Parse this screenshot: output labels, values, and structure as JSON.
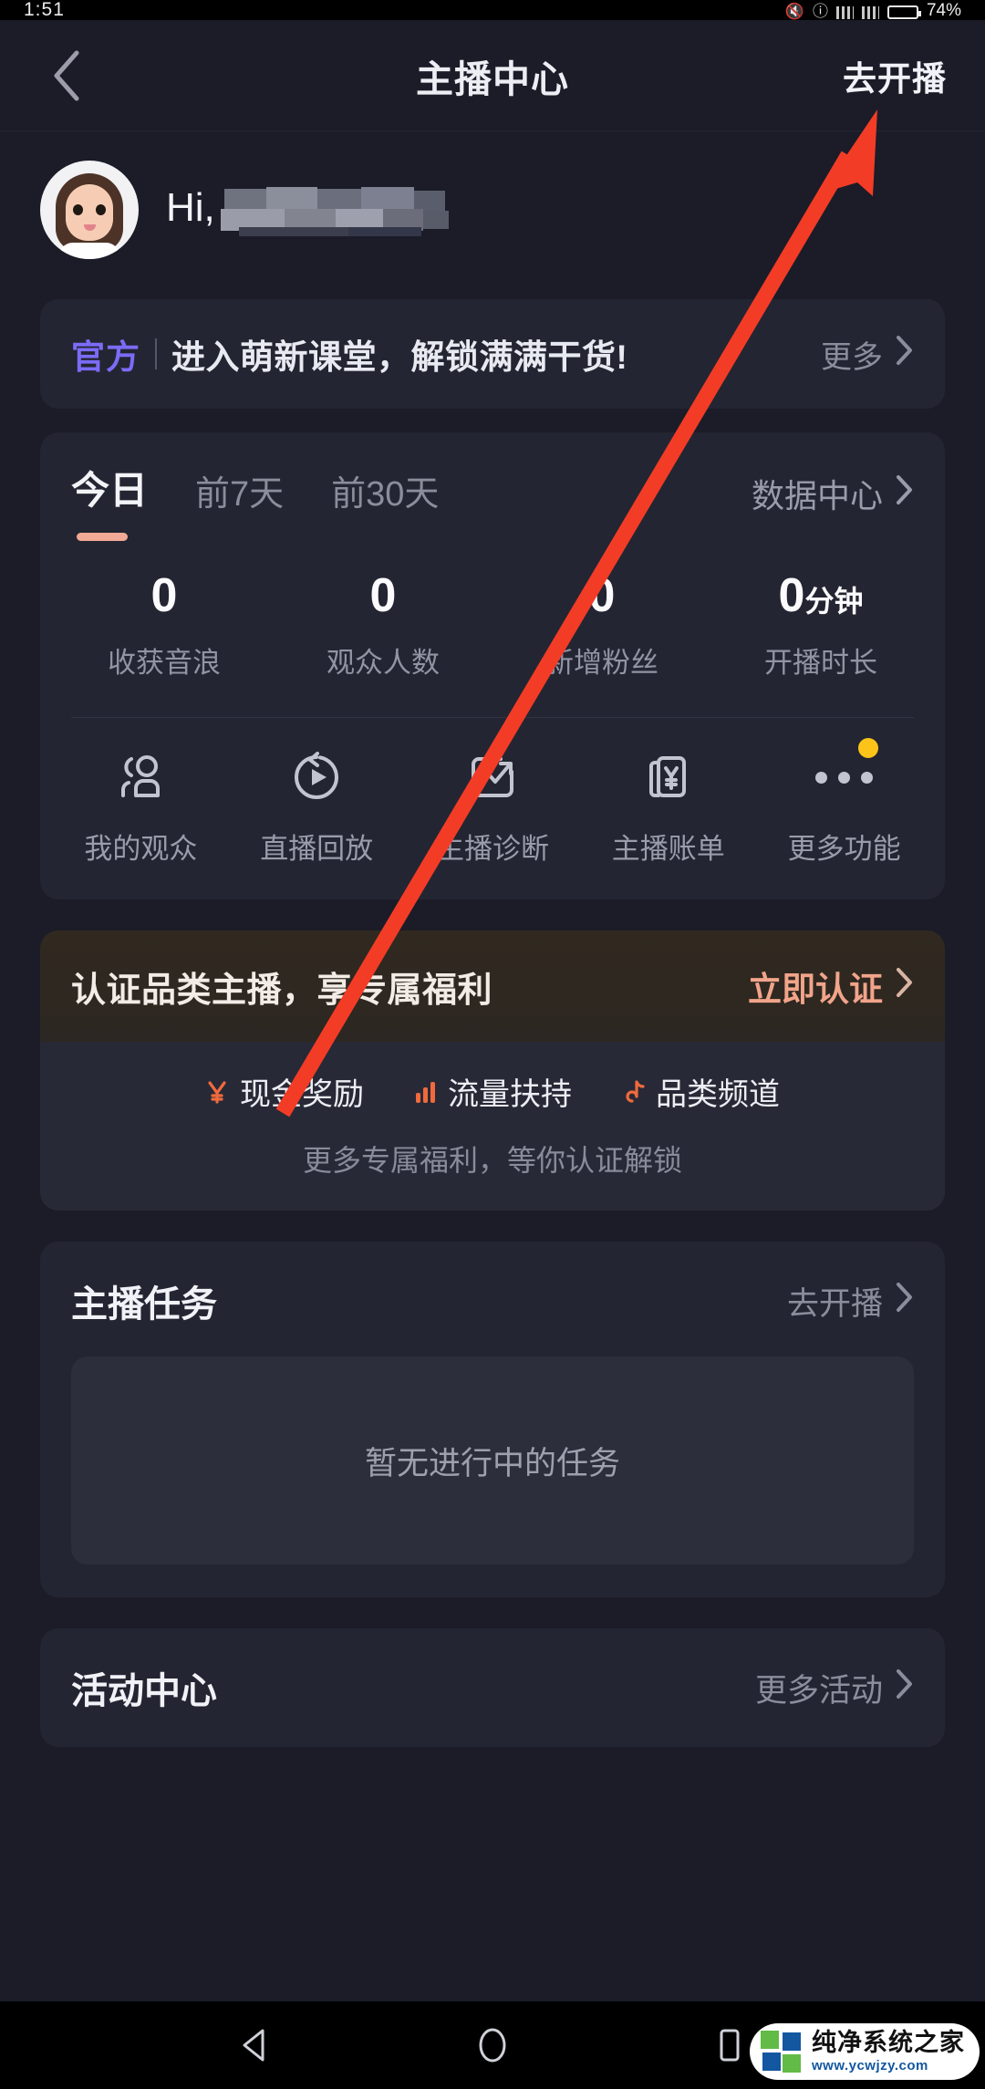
{
  "status_bar": {
    "time": "1:51",
    "battery_percent": "74%",
    "icons": [
      "mute-icon",
      "vpn-icon",
      "signal-icon",
      "signal-icon",
      "battery-icon"
    ]
  },
  "navbar": {
    "back_icon": "chevron-left-icon",
    "title": "主播中心",
    "action_label": "去开播"
  },
  "greeting": {
    "avatar": "avatar-image",
    "hi_text": "Hi,",
    "username_redacted": true
  },
  "banner": {
    "badge": "官方",
    "text": "进入萌新课堂，解锁满满干货!",
    "more_label": "更多",
    "chevron": "chevron-right-icon",
    "badge_color": "#7b6cf6"
  },
  "data_card": {
    "tabs": [
      {
        "label": "今日",
        "active": true
      },
      {
        "label": "前7天",
        "active": false
      },
      {
        "label": "前30天",
        "active": false
      }
    ],
    "data_center_label": "数据中心",
    "active_indicator_color": "#f2a995",
    "stats": [
      {
        "value": "0",
        "unit": "",
        "label": "收获音浪"
      },
      {
        "value": "0",
        "unit": "",
        "label": "观众人数"
      },
      {
        "value": "0",
        "unit": "",
        "label": "新增粉丝"
      },
      {
        "value": "0",
        "unit": "分钟",
        "label": "开播时长"
      }
    ],
    "quick_actions": [
      {
        "label": "我的观众",
        "icon": "people-icon",
        "badge": false
      },
      {
        "label": "直播回放",
        "icon": "replay-icon",
        "badge": false
      },
      {
        "label": "主播诊断",
        "icon": "chart-trend-icon",
        "badge": false
      },
      {
        "label": "主播账单",
        "icon": "bill-yen-icon",
        "badge": false
      },
      {
        "label": "更多功能",
        "icon": "more-dots-icon",
        "badge": true
      }
    ]
  },
  "certification": {
    "title": "认证品类主播，享专属福利",
    "cta_label": "立即认证",
    "cta_color": "#f2a48a",
    "perks": [
      {
        "label": "现金奖励",
        "icon": "yen-icon"
      },
      {
        "label": "流量扶持",
        "icon": "bar-chart-icon"
      },
      {
        "label": "品类频道",
        "icon": "music-note-icon"
      }
    ],
    "subtext": "更多专属福利，等你认证解锁"
  },
  "tasks": {
    "title": "主播任务",
    "link_label": "去开播",
    "empty_text": "暂无进行中的任务"
  },
  "activity": {
    "title": "活动中心",
    "link_label": "更多活动"
  },
  "annotation": {
    "type": "arrow",
    "color": "#f33c26"
  },
  "android_nav": {
    "back_icon": "triangle-back-icon",
    "home_icon": "circle-home-icon",
    "recents_icon": "square-recents-icon"
  },
  "watermark": {
    "title": "纯净系统之家",
    "url": "www.ycwjzy.com"
  }
}
